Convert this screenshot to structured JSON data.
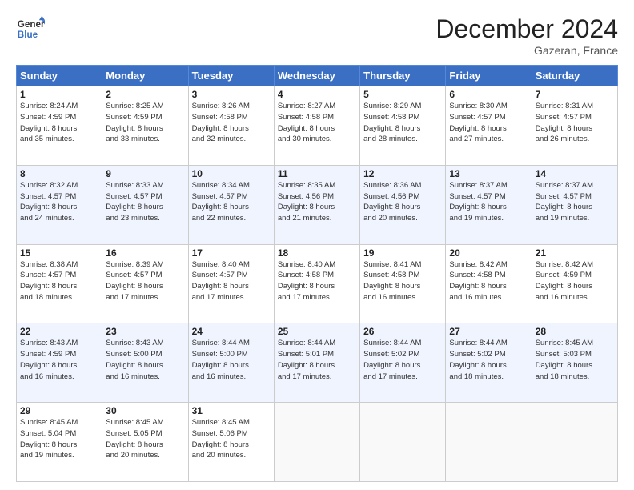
{
  "header": {
    "logo_line1": "General",
    "logo_line2": "Blue",
    "month": "December 2024",
    "location": "Gazeran, France"
  },
  "days_of_week": [
    "Sunday",
    "Monday",
    "Tuesday",
    "Wednesday",
    "Thursday",
    "Friday",
    "Saturday"
  ],
  "weeks": [
    [
      {
        "day": "1",
        "info": "Sunrise: 8:24 AM\nSunset: 4:59 PM\nDaylight: 8 hours\nand 35 minutes."
      },
      {
        "day": "2",
        "info": "Sunrise: 8:25 AM\nSunset: 4:59 PM\nDaylight: 8 hours\nand 33 minutes."
      },
      {
        "day": "3",
        "info": "Sunrise: 8:26 AM\nSunset: 4:58 PM\nDaylight: 8 hours\nand 32 minutes."
      },
      {
        "day": "4",
        "info": "Sunrise: 8:27 AM\nSunset: 4:58 PM\nDaylight: 8 hours\nand 30 minutes."
      },
      {
        "day": "5",
        "info": "Sunrise: 8:29 AM\nSunset: 4:58 PM\nDaylight: 8 hours\nand 28 minutes."
      },
      {
        "day": "6",
        "info": "Sunrise: 8:30 AM\nSunset: 4:57 PM\nDaylight: 8 hours\nand 27 minutes."
      },
      {
        "day": "7",
        "info": "Sunrise: 8:31 AM\nSunset: 4:57 PM\nDaylight: 8 hours\nand 26 minutes."
      }
    ],
    [
      {
        "day": "8",
        "info": "Sunrise: 8:32 AM\nSunset: 4:57 PM\nDaylight: 8 hours\nand 24 minutes."
      },
      {
        "day": "9",
        "info": "Sunrise: 8:33 AM\nSunset: 4:57 PM\nDaylight: 8 hours\nand 23 minutes."
      },
      {
        "day": "10",
        "info": "Sunrise: 8:34 AM\nSunset: 4:57 PM\nDaylight: 8 hours\nand 22 minutes."
      },
      {
        "day": "11",
        "info": "Sunrise: 8:35 AM\nSunset: 4:56 PM\nDaylight: 8 hours\nand 21 minutes."
      },
      {
        "day": "12",
        "info": "Sunrise: 8:36 AM\nSunset: 4:56 PM\nDaylight: 8 hours\nand 20 minutes."
      },
      {
        "day": "13",
        "info": "Sunrise: 8:37 AM\nSunset: 4:57 PM\nDaylight: 8 hours\nand 19 minutes."
      },
      {
        "day": "14",
        "info": "Sunrise: 8:37 AM\nSunset: 4:57 PM\nDaylight: 8 hours\nand 19 minutes."
      }
    ],
    [
      {
        "day": "15",
        "info": "Sunrise: 8:38 AM\nSunset: 4:57 PM\nDaylight: 8 hours\nand 18 minutes."
      },
      {
        "day": "16",
        "info": "Sunrise: 8:39 AM\nSunset: 4:57 PM\nDaylight: 8 hours\nand 17 minutes."
      },
      {
        "day": "17",
        "info": "Sunrise: 8:40 AM\nSunset: 4:57 PM\nDaylight: 8 hours\nand 17 minutes."
      },
      {
        "day": "18",
        "info": "Sunrise: 8:40 AM\nSunset: 4:58 PM\nDaylight: 8 hours\nand 17 minutes."
      },
      {
        "day": "19",
        "info": "Sunrise: 8:41 AM\nSunset: 4:58 PM\nDaylight: 8 hours\nand 16 minutes."
      },
      {
        "day": "20",
        "info": "Sunrise: 8:42 AM\nSunset: 4:58 PM\nDaylight: 8 hours\nand 16 minutes."
      },
      {
        "day": "21",
        "info": "Sunrise: 8:42 AM\nSunset: 4:59 PM\nDaylight: 8 hours\nand 16 minutes."
      }
    ],
    [
      {
        "day": "22",
        "info": "Sunrise: 8:43 AM\nSunset: 4:59 PM\nDaylight: 8 hours\nand 16 minutes."
      },
      {
        "day": "23",
        "info": "Sunrise: 8:43 AM\nSunset: 5:00 PM\nDaylight: 8 hours\nand 16 minutes."
      },
      {
        "day": "24",
        "info": "Sunrise: 8:44 AM\nSunset: 5:00 PM\nDaylight: 8 hours\nand 16 minutes."
      },
      {
        "day": "25",
        "info": "Sunrise: 8:44 AM\nSunset: 5:01 PM\nDaylight: 8 hours\nand 17 minutes."
      },
      {
        "day": "26",
        "info": "Sunrise: 8:44 AM\nSunset: 5:02 PM\nDaylight: 8 hours\nand 17 minutes."
      },
      {
        "day": "27",
        "info": "Sunrise: 8:44 AM\nSunset: 5:02 PM\nDaylight: 8 hours\nand 18 minutes."
      },
      {
        "day": "28",
        "info": "Sunrise: 8:45 AM\nSunset: 5:03 PM\nDaylight: 8 hours\nand 18 minutes."
      }
    ],
    [
      {
        "day": "29",
        "info": "Sunrise: 8:45 AM\nSunset: 5:04 PM\nDaylight: 8 hours\nand 19 minutes."
      },
      {
        "day": "30",
        "info": "Sunrise: 8:45 AM\nSunset: 5:05 PM\nDaylight: 8 hours\nand 20 minutes."
      },
      {
        "day": "31",
        "info": "Sunrise: 8:45 AM\nSunset: 5:06 PM\nDaylight: 8 hours\nand 20 minutes."
      },
      null,
      null,
      null,
      null
    ]
  ]
}
